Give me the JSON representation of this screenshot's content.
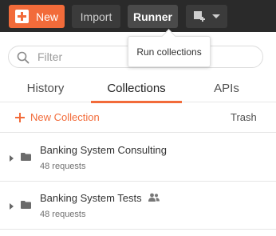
{
  "header": {
    "new_label": "New",
    "import_label": "Import",
    "runner_label": "Runner",
    "window_icon": "new-window-icon",
    "tooltip": "Run collections"
  },
  "search": {
    "placeholder": "Filter",
    "value": ""
  },
  "tabs": [
    {
      "label": "History",
      "active": false
    },
    {
      "label": "Collections",
      "active": true
    },
    {
      "label": "APIs",
      "active": false
    }
  ],
  "toolbar": {
    "new_collection_label": "New Collection",
    "trash_label": "Trash"
  },
  "collections": [
    {
      "name": "Banking System Consulting",
      "subtitle": "48 requests",
      "shared": false
    },
    {
      "name": "Banking System Tests",
      "subtitle": "48 requests",
      "shared": true
    }
  ],
  "colors": {
    "accent": "#f26b3a",
    "topbar": "#2a2a2a"
  }
}
